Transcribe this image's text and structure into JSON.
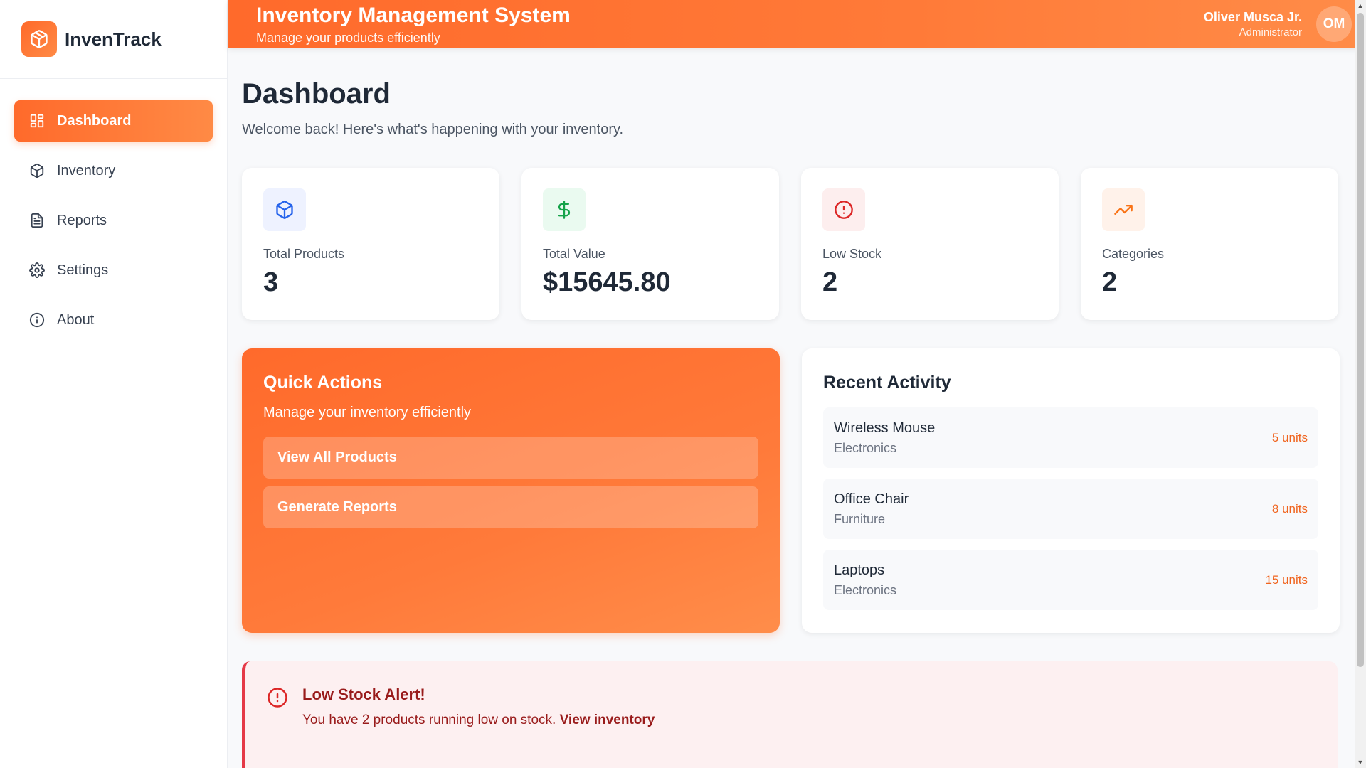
{
  "brand": {
    "name": "InvenTrack"
  },
  "sidebar": {
    "items": [
      {
        "label": "Dashboard",
        "icon": "dashboard-icon",
        "active": true
      },
      {
        "label": "Inventory",
        "icon": "box-icon"
      },
      {
        "label": "Reports",
        "icon": "file-icon"
      },
      {
        "label": "Settings",
        "icon": "gear-icon"
      },
      {
        "label": "About",
        "icon": "info-icon"
      }
    ]
  },
  "header": {
    "title": "Inventory Management System",
    "subtitle": "Manage your products efficiently",
    "user_name": "Oliver Musca Jr.",
    "user_role": "Administrator",
    "avatar_initials": "OM"
  },
  "page": {
    "title": "Dashboard",
    "subtitle": "Welcome back! Here's what's happening with your inventory."
  },
  "stats": [
    {
      "label": "Total Products",
      "value": "3",
      "icon": "box-icon",
      "color": "#2563eb"
    },
    {
      "label": "Total Value",
      "value": "$15645.80",
      "icon": "dollar-icon",
      "color": "#16a34a"
    },
    {
      "label": "Low Stock",
      "value": "2",
      "icon": "alert-circle-icon",
      "color": "#dc2626"
    },
    {
      "label": "Categories",
      "value": "2",
      "icon": "trending-up-icon",
      "color": "#f97316"
    }
  ],
  "quick_actions": {
    "title": "Quick Actions",
    "subtitle": "Manage your inventory efficiently",
    "buttons": [
      "View All Products",
      "Generate Reports"
    ]
  },
  "recent_activity": {
    "title": "Recent Activity",
    "items": [
      {
        "name": "Wireless Mouse",
        "category": "Electronics",
        "units": "5 units"
      },
      {
        "name": "Office Chair",
        "category": "Furniture",
        "units": "8 units"
      },
      {
        "name": "Laptops",
        "category": "Electronics",
        "units": "15 units"
      }
    ]
  },
  "alert": {
    "title": "Low Stock Alert!",
    "text": "You have 2 products running low on stock. ",
    "link": "View inventory"
  },
  "colors": {
    "accent": "#ff6a2b",
    "danger": "#dc2626"
  }
}
